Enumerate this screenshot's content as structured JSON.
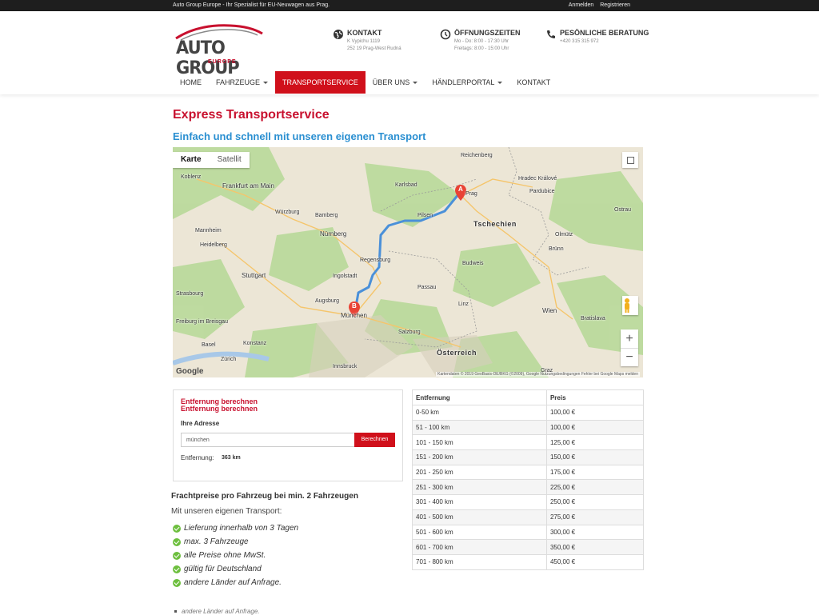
{
  "topbar": {
    "tagline": "Auto Group Europe - Ihr Spezialist für EU-Neuwagen aus Prag.",
    "login": "Anmelden",
    "register": "Registrieren"
  },
  "logo": {
    "name": "AUTO GROUP",
    "sub": "EUROPE"
  },
  "contact": {
    "title": "KONTAKT",
    "line1": "K Vypichu 1119",
    "line2": "252 19 Prag-West Rudná"
  },
  "hours": {
    "title": "ÖFFNUNGSZEITEN",
    "line1": "Mo - Do: 8:00 - 17:30 Uhr",
    "line2": "Freitags: 8:00 - 15:00 Uhr"
  },
  "advice": {
    "title": "PESÖNLICHE BERATUNG",
    "line1": "+420 315 315 972"
  },
  "nav": {
    "home": "HOME",
    "cars": "FAHRZEUGE",
    "transport": "TRANSPORTSERVICE",
    "about": "ÜBER UNS",
    "dealer": "HÄNDLERPORTAL",
    "contact": "KONTAKT"
  },
  "page": {
    "title": "Express Transportservice",
    "subtitle": "Einfach und schnell mit unseren eigenen Transport"
  },
  "map": {
    "tab_map": "Karte",
    "tab_sat": "Satellit",
    "zoom_in": "+",
    "zoom_out": "−",
    "marker_a": "A",
    "marker_b": "B",
    "cities": {
      "koblenz": "Koblenz",
      "frankfurt": "Frankfurt am Main",
      "wurzburg": "Würzburg",
      "bamberg": "Bamberg",
      "nurnberg": "Nürnberg",
      "mannheim": "Mannheim",
      "heidelberg": "Heidelberg",
      "stuttgart": "Stuttgart",
      "ingolstadt": "Ingolstadt",
      "regensburg": "Regensburg",
      "augsburg": "Augsburg",
      "munchen": "München",
      "freiburg": "Freiburg im Breisgau",
      "konstanz": "Konstanz",
      "zurich": "Zürich",
      "innsbruck": "Innsbruck",
      "karlsbad": "Karlsbad",
      "pilsen": "Pilsen",
      "prag": "Prag",
      "reichenberg": "Reichenberg",
      "tschechien": "Tschechien",
      "budweis": "Budweis",
      "linz": "Linz",
      "brunn": "Brünn",
      "olmutz": "Olmütz",
      "ostrau": "Ostrau",
      "wien": "Wien",
      "bratislava": "Bratislava",
      "osterreich": "Österreich",
      "pardubice": "Pardubice",
      "hradec": "Hradec Králové",
      "strasbourg": "Strasbourg",
      "basel": "Basel",
      "graz": "Graz",
      "salzburg": "Salzburg",
      "passau": "Passau"
    },
    "footer": "Kartendaten © 2019 GeoBasis-DE/BKG (©2009), Google    Nutzungsbedingungen    Fehler bei Google Maps melden",
    "google": "Google"
  },
  "calc": {
    "title": "Entfernung berechnen",
    "title_dup": "Entfernung berechnen",
    "label": "Ihre Adresse",
    "input_value": "münchen",
    "button": "Berechnen",
    "dist_label": "Entfernung:",
    "dist_value": "363 km"
  },
  "prices": {
    "title": "Frachtpreise pro Fahrzeug bei min. 2 Fahrzeugen",
    "intro": "Mit unseren eigenen Transport:",
    "features": [
      "Lieferung innerhalb von 3 Tagen",
      "max. 3 Fahrzeuge",
      "alle Preise ohne MwSt.",
      "gültig für Deutschland",
      "andere Länder auf Anfrage."
    ],
    "ghost": "andere Länder auf Anfrage."
  },
  "table": {
    "headers": [
      "Entfernung",
      "Preis"
    ],
    "rows": [
      [
        "0-50 km",
        "100,00 €"
      ],
      [
        "51 - 100 km",
        "100,00 €"
      ],
      [
        "101 - 150 km",
        "125,00 €"
      ],
      [
        "151 - 200 km",
        "150,00 €"
      ],
      [
        "201 - 250 km",
        "175,00 €"
      ],
      [
        "251 - 300 km",
        "225,00 €"
      ],
      [
        "301 - 400 km",
        "250,00 €"
      ],
      [
        "401 - 500 km",
        "275,00 €"
      ],
      [
        "501 - 600 km",
        "300,00 €"
      ],
      [
        "601 - 700 km",
        "350,00 €"
      ],
      [
        "701 - 800 km",
        "450,00 €"
      ]
    ]
  },
  "colors": {
    "brand_red": "#d0101b",
    "title_red": "#c8102e",
    "subtitle_blue": "#2a8fd1",
    "route": "#4a90d9",
    "check_green": "#6dbf3e"
  }
}
